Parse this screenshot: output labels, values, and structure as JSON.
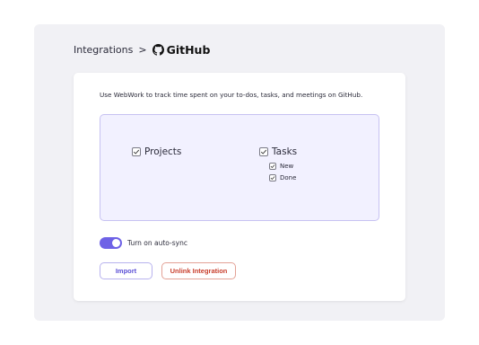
{
  "breadcrumb": {
    "parent": "Integrations",
    "separator": ">",
    "current": "GitHub",
    "current_icon": "github-icon"
  },
  "description": "Use WebWork to track time spent on your to-dos, tasks, and meetings on GitHub.",
  "options": {
    "projects": {
      "label": "Projects",
      "checked": true
    },
    "tasks": {
      "label": "Tasks",
      "checked": true
    },
    "new": {
      "label": "New",
      "checked": true
    },
    "done": {
      "label": "Done",
      "checked": true
    }
  },
  "autosync": {
    "label": "Turn on auto-sync",
    "enabled": true
  },
  "buttons": {
    "import": "Import",
    "unlink": "Unlink Integration"
  },
  "colors": {
    "accent": "#6e62e6",
    "danger": "#c9402e",
    "panel": "#f2f1ff"
  }
}
